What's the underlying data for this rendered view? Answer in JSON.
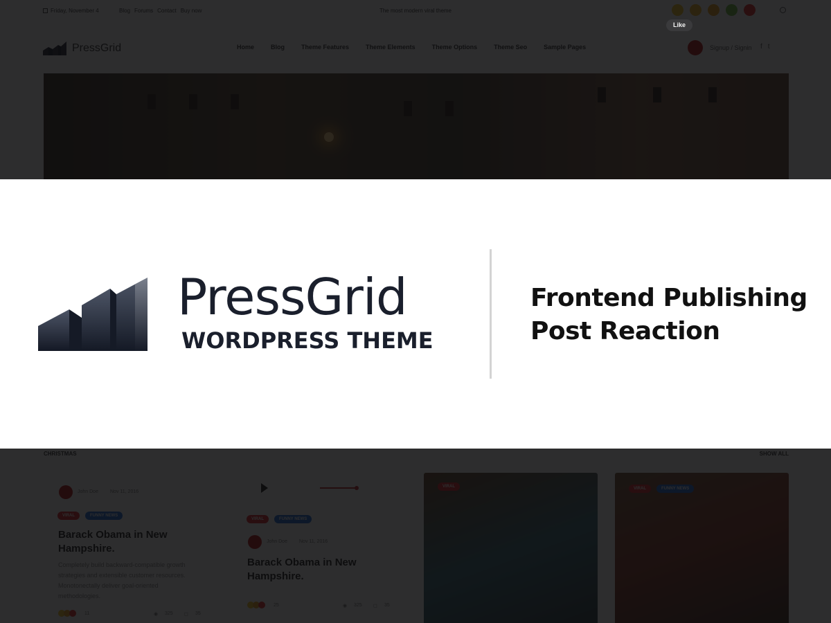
{
  "topbar": {
    "date": "Friday, November 4",
    "links": [
      "Blog",
      "Forums",
      "Contact",
      "Buy now"
    ],
    "tagline": "The most modern viral theme",
    "reactions": [
      "smile-emoji",
      "love-emoji",
      "wow-emoji",
      "cool-emoji",
      "angry-emoji"
    ],
    "like_tooltip": "Like"
  },
  "nav": {
    "brand": "PressGrid",
    "menu": [
      "Home",
      "Blog",
      "Theme Features",
      "Theme Elements",
      "Theme Options",
      "Theme Seo",
      "Sample Pages"
    ],
    "signup": "Signup / Signin",
    "social": [
      "facebook-icon",
      "twitter-icon"
    ]
  },
  "banner": {
    "logo_name": "PressGrid",
    "logo_sub": "WORDPRESS THEME",
    "features": [
      "Frontend Publishing",
      "Post Reaction"
    ]
  },
  "section": {
    "title": "CHRISTMAS",
    "show_all": "SHOW ALL"
  },
  "cards": [
    {
      "author": "John Doe",
      "date": "Nov 11, 2016",
      "tags": [
        "Viral",
        "Funny News"
      ],
      "title": "Barack Obama in New Hampshire.",
      "excerpt": "Completely build backward-compatible growth strategies and extensible customer resources. Monotonectally deliver goal-oriented methodologies.",
      "reaction_count": "11",
      "views": "325",
      "comments": "35"
    },
    {
      "author": "John Doe",
      "date": "Nov 11, 2016",
      "tags": [
        "Viral",
        "Funny News"
      ],
      "title": "Barack Obama in New Hampshire.",
      "reaction_count": "25",
      "views": "325",
      "comments": "35"
    },
    {
      "tags": [
        "Viral"
      ]
    },
    {
      "tags": [
        "Viral",
        "Funny News"
      ]
    }
  ],
  "colors": {
    "brand_dark": "#1a1f2c",
    "accent_red": "#e0262b",
    "accent_blue": "#1e6ad8",
    "divider": "#d3d3d3"
  }
}
